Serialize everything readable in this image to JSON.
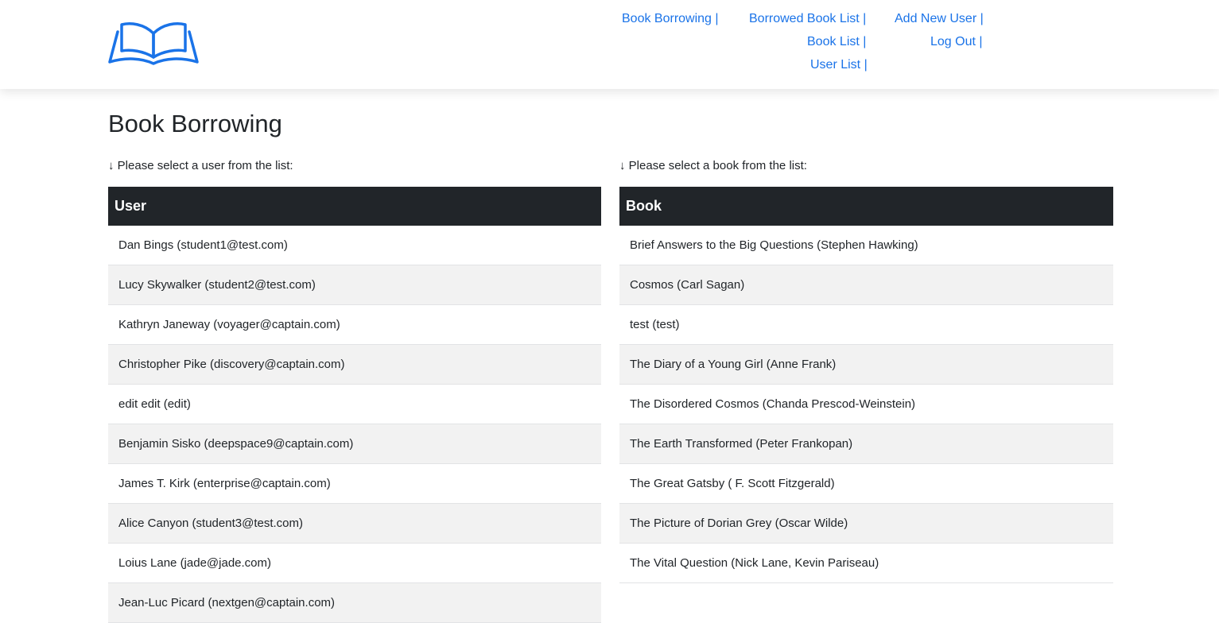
{
  "header": {
    "nav": {
      "book_borrowing": "Book Borrowing |",
      "borrowed_book_list": "Borrowed Book List |",
      "add_new_user": "Add New User |",
      "book_list": "Book List |",
      "log_out": "Log Out |",
      "user_list": "User List |"
    },
    "link_color": "#1a73e8"
  },
  "page": {
    "title": "Book Borrowing",
    "user_instruction": "↓ Please select a user from the list:",
    "book_instruction": "↓ Please select a book from the list:"
  },
  "users": {
    "header": "User",
    "items": [
      "Dan Bings (student1@test.com)",
      "Lucy Skywalker (student2@test.com)",
      "Kathryn Janeway (voyager@captain.com)",
      "Christopher Pike (discovery@captain.com)",
      "edit edit (edit)",
      "Benjamin Sisko (deepspace9@captain.com)",
      "James T. Kirk (enterprise@captain.com)",
      "Alice Canyon (student3@test.com)",
      "Loius Lane (jade@jade.com)",
      "Jean-Luc Picard (nextgen@captain.com)"
    ]
  },
  "books": {
    "header": "Book",
    "items": [
      "Brief Answers to the Big Questions (Stephen Hawking)",
      "Cosmos (Carl Sagan)",
      "test (test)",
      "The Diary of a Young Girl (Anne Frank)",
      "The Disordered Cosmos (Chanda Prescod-Weinstein)",
      "The Earth Transformed (Peter Frankopan)",
      "The Great Gatsby ( F. Scott Fitzgerald)",
      "The Picture of Dorian Grey (Oscar Wilde)",
      "The Vital Question (Nick Lane, Kevin Pariseau)"
    ]
  },
  "colors": {
    "table_header_bg": "#212529",
    "row_alt_bg": "#f2f2f2"
  }
}
